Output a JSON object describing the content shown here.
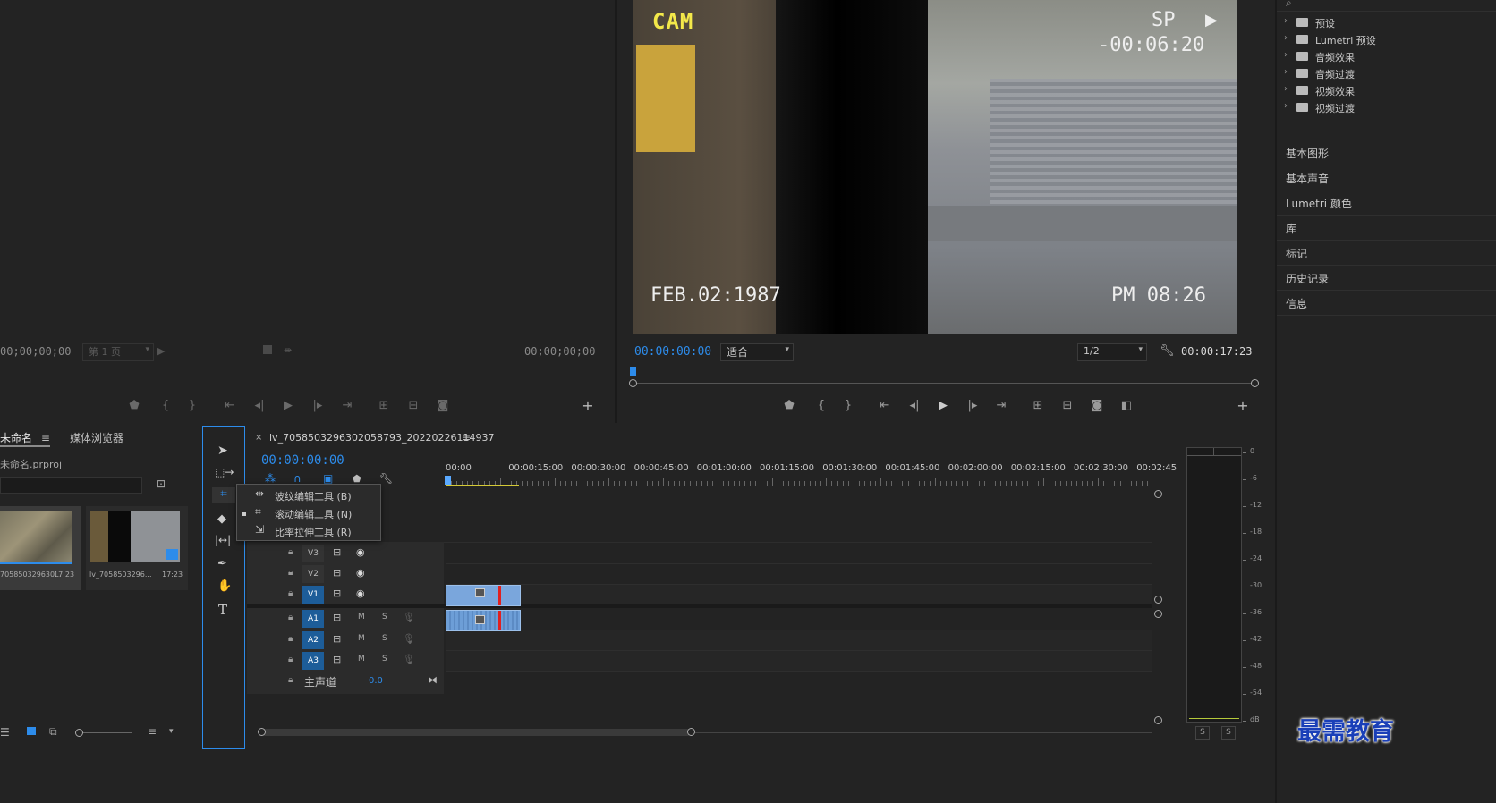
{
  "source_monitor": {
    "timecode_left": "00;00;00;00",
    "page_label": "第 1 页",
    "timecode_right": "00;00;00;00"
  },
  "program_monitor": {
    "video_overlay": {
      "top_left": "CAM",
      "top_right_mode": "SP",
      "top_right_time": "-00:06:20",
      "bottom_left": "FEB.02:1987",
      "bottom_right": "PM 08:26"
    },
    "timecode": "00:00:00:00",
    "fit_select": "适合",
    "quality_select": "1/2",
    "duration": "00:00:17:23"
  },
  "effects_panel": {
    "items": [
      {
        "label": "预设",
        "icon": "folder-star-icon"
      },
      {
        "label": "Lumetri 预设",
        "icon": "folder-star-icon"
      },
      {
        "label": "音频效果",
        "icon": "folder-icon"
      },
      {
        "label": "音频过渡",
        "icon": "folder-icon"
      },
      {
        "label": "视频效果",
        "icon": "folder-icon"
      },
      {
        "label": "视频过渡",
        "icon": "folder-icon"
      }
    ],
    "sections": [
      "基本图形",
      "基本声音",
      "Lumetri 颜色",
      "库",
      "标记",
      "历史记录",
      "信息"
    ]
  },
  "project_panel": {
    "tab_project": "未命名",
    "tab_media": "媒体浏览器",
    "project_file": "未命名.prproj",
    "clips": [
      {
        "name": "705850329630...",
        "duration": "17:23"
      },
      {
        "name": "lv_7058503296...",
        "duration": "17:23"
      }
    ]
  },
  "tools_popup": {
    "items": [
      {
        "label": "波纹编辑工具 (B)",
        "icon": "ripple-edit-icon",
        "selected": false
      },
      {
        "label": "滚动编辑工具 (N)",
        "icon": "rolling-edit-icon",
        "selected": true
      },
      {
        "label": "比率拉伸工具 (R)",
        "icon": "rate-stretch-icon",
        "selected": false
      }
    ]
  },
  "timeline": {
    "sequence_name": "lv_7058503296302058793_20220226114937",
    "timecode": "00:00:00:00",
    "ruler": [
      "00:00",
      "00:00:15:00",
      "00:00:30:00",
      "00:00:45:00",
      "00:01:00:00",
      "00:01:15:00",
      "00:01:30:00",
      "00:01:45:00",
      "00:02:00:00",
      "00:02:15:00",
      "00:02:30:00",
      "00:02:45:"
    ],
    "video_tracks": [
      "V3",
      "V2",
      "V1"
    ],
    "audio_tracks": [
      "A1",
      "A2",
      "A3"
    ],
    "mute_label": "M",
    "solo_label": "S",
    "master_label": "主声道",
    "master_value": "0.0"
  },
  "audio_meter": {
    "scale": [
      "0",
      "-6",
      "-12",
      "-18",
      "-24",
      "-30",
      "-36",
      "-42",
      "-48",
      "-54",
      "dB"
    ],
    "solo_buttons": [
      "S",
      "S"
    ]
  },
  "watermark": "最需教育",
  "colors": {
    "accent_blue": "#2d8ceb",
    "clip_blue": "#6d9ed7",
    "playhead": "#5aa9ff",
    "red_marker": "#e02020"
  }
}
